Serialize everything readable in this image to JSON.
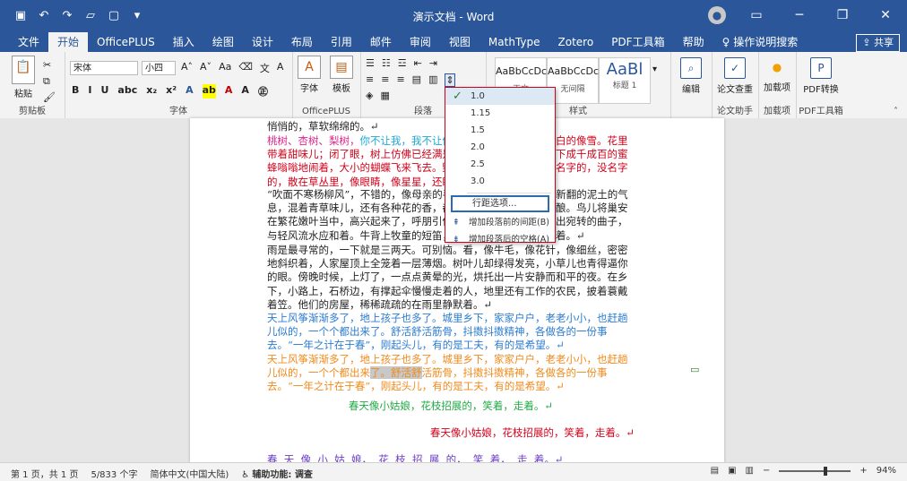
{
  "window": {
    "title": "演示文档 - Word"
  },
  "tabs": [
    "文件",
    "开始",
    "OfficePLUS",
    "插入",
    "绘图",
    "设计",
    "布局",
    "引用",
    "邮件",
    "审阅",
    "视图",
    "MathType",
    "Zotero",
    "PDF工具箱",
    "帮助",
    "操作说明搜索"
  ],
  "share_label": "共享",
  "ribbon": {
    "clipboard": {
      "paste": "粘贴",
      "label": "剪贴板"
    },
    "font": {
      "name": "宋体",
      "size": "小四",
      "label": "字体"
    },
    "officeplus": {
      "font_btn": "字体",
      "template_btn": "模板",
      "label": "OfficePLUS"
    },
    "paragraph": {
      "label": "段落"
    },
    "styles": {
      "label": "样式",
      "cards": [
        {
          "sample": "AaBbCcDc",
          "name": "正文"
        },
        {
          "sample": "AaBbCcDc",
          "name": "无间隔"
        },
        {
          "sample": "AaBl",
          "name": "标题 1"
        }
      ]
    },
    "editing": {
      "label": "编辑"
    },
    "paper": {
      "btn": "论文查重",
      "label": "论文助手"
    },
    "addin": {
      "btn": "加载项",
      "label": "加载项"
    },
    "pdf": {
      "btn": "PDF转换",
      "label": "PDF工具箱"
    }
  },
  "menu": {
    "items": [
      "1.0",
      "1.15",
      "1.5",
      "2.0",
      "2.5",
      "3.0"
    ],
    "checked": "1.0",
    "options": "行距选项...",
    "before": "增加段落前的间距(B)",
    "after": "增加段落后的空格(A)"
  },
  "doc": {
    "p1": "悄悄的，草软绵绵的。↵",
    "p2a": "桃树、杏树、梨树，",
    "p2b": "你不让我，我不让你",
    "p2c": "红的像火，粉的像霞，白的像雪。花里带着甜味儿；闭了眼，树上仿佛已经满是桃儿、杏儿、梨儿。花下成千成百的蜜蜂嗡嗡地闹着，大小的蝴蝶飞来飞去。野花遍地是：杂样儿，有名字的，没名字的，散在草丛里，像眼睛，像星星，还眨呀眨的。↵",
    "p3": "“吹面不寒杨柳风”，不错的，像母亲的手抚摸着你。风里带来些新翻的泥土的气息，混着青草味儿，还有各种花的香，都在微微润湿的空气里酝酿。鸟儿将巢安在繁花嫩叶当中，高兴起来了，呼朋引伴地卖弄清脆的喉咙，唱出宛转的曲子，与轻风流水应和着。牛背上牧童的短笛，这时候也成天嘹亮地响着。↵",
    "p4": "雨是最寻常的，一下就是三两天。可别恼。看，像牛毛，像花针，像细丝，密密地斜织着，人家屋顶上全笼着一层薄烟。树叶儿却绿得发亮，小草儿也青得逼你的眼。傍晚时候，上灯了，一点点黄晕的光，烘托出一片安静而和平的夜。在乡下，小路上，石桥边，有撑起伞慢慢走着的人，地里还有工作的农民，披着蓑戴着笠。他们的房屋，稀稀疏疏的在雨里静默着。↵",
    "p5": "天上风筝渐渐多了，地上孩子也多了。城里乡下，家家户户，老老小小，也赶趟儿似的，一个个都出来了。舒活舒活筋骨，抖擞抖擞精神，各做各的一份事去。“一年之计在于春”，刚起头儿，有的是工夫，有的是希望。↵",
    "p6a": "天上风筝渐渐多了，地上孩子也多了。城里乡下，家家户户，老老小小，也赶趟儿似的，一个个都出来",
    "p6b": "了。舒活舒",
    "p6c": "活筋骨，抖擞抖擞精神，各做各的一份事去。“一年之计在于春”，刚起头儿，有的是工夫，有的是希望。↵",
    "p7": "春天像小姑娘，花枝招展的，笑着，走着。↵",
    "p8": "春天像小姑娘，花枝招展的，笑着，走着。↵",
    "p9": "春  天  像  小  姑  娘，  花  枝  招  展  的，  笑  着，  走  着。↵"
  },
  "colors": {
    "title_bar": "#2b579a",
    "menu_border": "#d0021b",
    "options_border": "#2b6cb0"
  },
  "status": {
    "page": "第 1 页，共 1 页",
    "words": "5/833 个字",
    "lang": "简体中文(中国大陆)",
    "access": "辅助功能: 调查",
    "zoom": "94%"
  }
}
